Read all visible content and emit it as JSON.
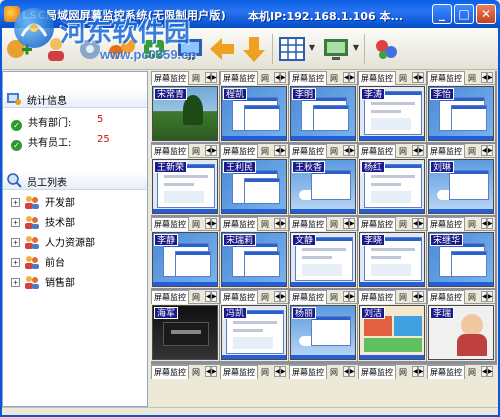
{
  "window": {
    "title": "LSC局域网屏幕监控系统(无限制用户版)",
    "ip_label": "本机IP:192.168.1.106",
    "ip_suffix": "本..."
  },
  "watermark": {
    "text": "河东软件园",
    "url": "www.pc0359.cn"
  },
  "toolbar": {
    "icons": [
      "add-icon",
      "settings-icon",
      "network-icon",
      "monitor-icon",
      "left-arrow-icon",
      "down-arrow-icon",
      "grid-layout-icon",
      "display-icon",
      "tools-icon"
    ]
  },
  "sidebar": {
    "stats_title": "统计信息",
    "stats": [
      {
        "label": "共有部门:",
        "value": "5"
      },
      {
        "label": "共有员工:",
        "value": "25"
      }
    ],
    "employees_title": "员工列表",
    "departments": [
      {
        "label": "开发部"
      },
      {
        "label": "技术部"
      },
      {
        "label": "人力资源部"
      },
      {
        "label": "前台"
      },
      {
        "label": "销售部"
      }
    ]
  },
  "grid": {
    "tab_label": "屏幕监控",
    "tab2_label": "网",
    "employees": [
      {
        "name": "宋常青",
        "scene": "nature"
      },
      {
        "name": "程凯",
        "scene": "desktop"
      },
      {
        "name": "李明",
        "scene": "desktop"
      },
      {
        "name": "李涛",
        "scene": "web"
      },
      {
        "name": "李怡",
        "scene": "desktop"
      },
      {
        "name": "王新荣",
        "scene": "web"
      },
      {
        "name": "王利民",
        "scene": "desktop"
      },
      {
        "name": "王秋香",
        "scene": "sky"
      },
      {
        "name": "杨红",
        "scene": "web"
      },
      {
        "name": "刘琳",
        "scene": "sky"
      },
      {
        "name": "李静",
        "scene": "desktop"
      },
      {
        "name": "宋瑞莉",
        "scene": "desktop"
      },
      {
        "name": "文静",
        "scene": "web"
      },
      {
        "name": "李晓",
        "scene": "web"
      },
      {
        "name": "宋继华",
        "scene": "desktop"
      },
      {
        "name": "海军",
        "scene": "dark"
      },
      {
        "name": "冯凯",
        "scene": "web"
      },
      {
        "name": "杨丽",
        "scene": "sky"
      },
      {
        "name": "刘洁",
        "scene": "colorful"
      },
      {
        "name": "李瑞",
        "scene": "portrait"
      }
    ]
  },
  "colors": {
    "titlebar": "#0b56d6",
    "name_tag": "#1a1a8a",
    "stat_value": "#c81010"
  }
}
